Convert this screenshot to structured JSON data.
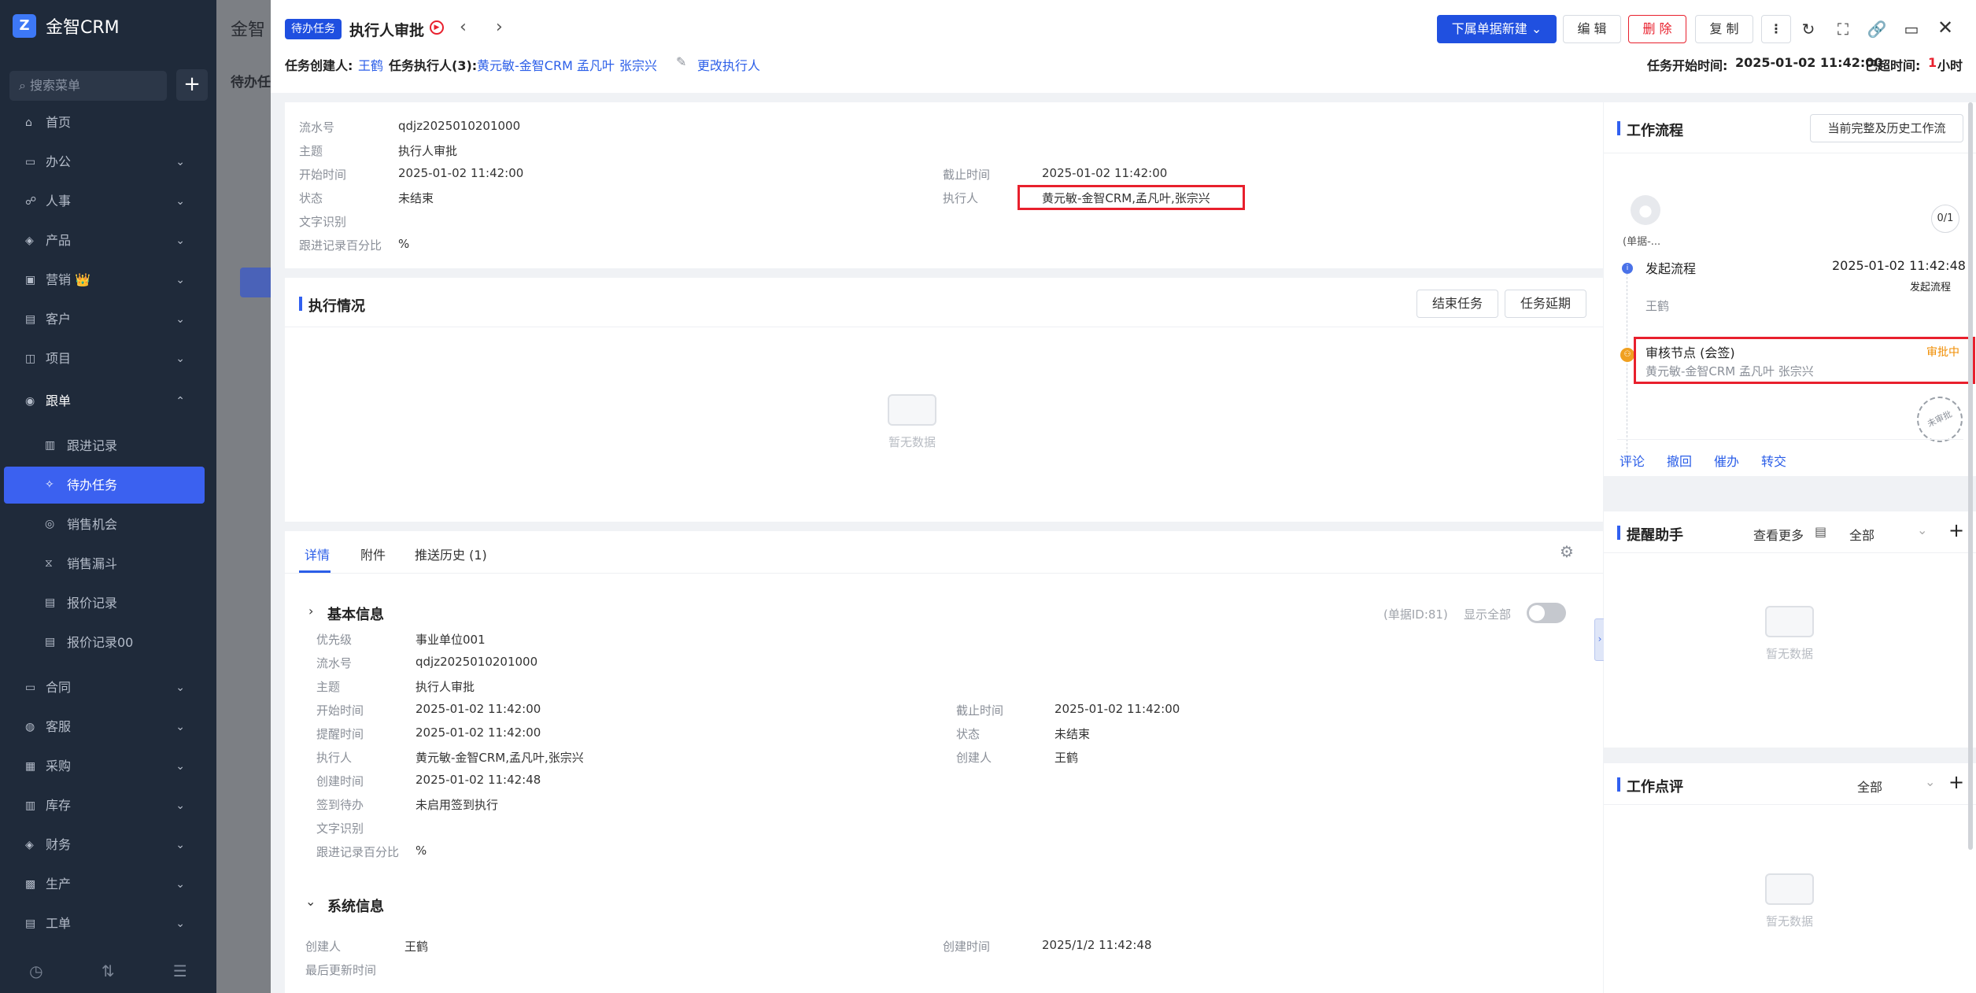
{
  "app": {
    "brand": "金智CRM",
    "search_placeholder": "搜索菜单"
  },
  "menu": [
    {
      "label": "首页",
      "icon": "home-icon"
    },
    {
      "label": "办公",
      "icon": "office-icon",
      "chevron": "down"
    },
    {
      "label": "人事",
      "icon": "people-icon",
      "chevron": "down"
    },
    {
      "label": "产品",
      "icon": "product-icon",
      "chevron": "down"
    },
    {
      "label": "营销",
      "icon": "marketing-icon",
      "badge": "👑",
      "chevron": "down"
    },
    {
      "label": "客户",
      "icon": "customer-icon",
      "chevron": "down"
    },
    {
      "label": "项目",
      "icon": "project-icon",
      "chevron": "down"
    },
    {
      "label": "跟单",
      "icon": "follow-icon",
      "chevron": "up"
    }
  ],
  "submenu": [
    {
      "label": "跟进记录"
    },
    {
      "label": "待办任务",
      "active": true
    },
    {
      "label": "销售机会"
    },
    {
      "label": "销售漏斗"
    },
    {
      "label": "报价记录"
    },
    {
      "label": "报价记录00"
    }
  ],
  "menu2": [
    {
      "label": "合同"
    },
    {
      "label": "客服"
    },
    {
      "label": "采购"
    },
    {
      "label": "库存"
    },
    {
      "label": "财务"
    },
    {
      "label": "生产"
    },
    {
      "label": "工单"
    }
  ],
  "bgpage": {
    "title": "金智",
    "sub": "待办任"
  },
  "header": {
    "tag": "待办任务",
    "title": "执行人审批",
    "creator_label": "任务创建人:",
    "creator": "王鹤",
    "executors_label": "任务执行人(3):",
    "executors": [
      "黄元敏-金智CRM",
      "孟凡叶",
      "张宗兴"
    ],
    "change_executor": "更改执行人",
    "start_label": "任务开始时间:",
    "start_time": "2025-01-02 11:42:00",
    "overdue_label": "已超时间:",
    "overdue_value": "1",
    "overdue_unit": "小时",
    "buttons": {
      "new_sub": "下属单据新建",
      "edit": "编 辑",
      "delete": "删 除",
      "copy": "复 制"
    }
  },
  "summary": {
    "rows": [
      {
        "label": "流水号",
        "value": "qdjz2025010201000"
      },
      {
        "label": "主题",
        "value": "执行人审批"
      },
      {
        "label": "开始时间",
        "value": "2025-01-02 11:42:00"
      },
      {
        "label": "状态",
        "value": "未结束"
      },
      {
        "label": "文字识别",
        "value": ""
      },
      {
        "label": "跟进记录百分比",
        "value": "%"
      }
    ],
    "right": [
      {
        "label": "截止时间",
        "value": "2025-01-02 11:42:00"
      },
      {
        "label": "执行人",
        "value": "黄元敏-金智CRM,孟凡叶,张宗兴"
      }
    ]
  },
  "execution": {
    "title": "执行情况",
    "end_task": "结束任务",
    "extend_task": "任务延期",
    "empty": "暂无数据"
  },
  "tabs": [
    {
      "label": "详情",
      "active": true
    },
    {
      "label": "附件"
    },
    {
      "label": "推送历史 (1)"
    }
  ],
  "basic_info": {
    "title": "基本信息",
    "doc_id": "(单据ID:81)",
    "show_all": "显示全部",
    "left": [
      {
        "label": "优先级",
        "value": "事业单位001"
      },
      {
        "label": "流水号",
        "value": "qdjz2025010201000"
      },
      {
        "label": "主题",
        "value": "执行人审批"
      },
      {
        "label": "开始时间",
        "value": "2025-01-02 11:42:00"
      },
      {
        "label": "提醒时间",
        "value": "2025-01-02 11:42:00"
      },
      {
        "label": "执行人",
        "value": "黄元敏-金智CRM,孟凡叶,张宗兴"
      },
      {
        "label": "创建时间",
        "value": "2025-01-02 11:42:48"
      },
      {
        "label": "签到待办",
        "value": "未启用签到执行"
      },
      {
        "label": "文字识别",
        "value": ""
      },
      {
        "label": "跟进记录百分比",
        "value": "%"
      }
    ],
    "right": [
      {
        "label": "截止时间",
        "value": "2025-01-02 11:42:00"
      },
      {
        "label": "状态",
        "value": "未结束"
      },
      {
        "label": "创建人",
        "value": "王鹤"
      }
    ]
  },
  "system_info": {
    "title": "系统信息",
    "creator_label": "创建人",
    "creator": "王鹤",
    "created_label": "创建时间",
    "created": "2025/1/2 11:42:48",
    "updated_label": "最后更新时间"
  },
  "workflow": {
    "title": "工作流程",
    "history_button": "当前完整及历史工作流",
    "avatar_caption": "(单据-...",
    "progress": "0/1",
    "steps": [
      {
        "name": "发起流程",
        "time": "2025-01-02 11:42:48",
        "status": "发起流程",
        "person": "王鹤"
      },
      {
        "name": "审核节点 (会签)",
        "status": "审批中",
        "person": "黄元敏-金智CRM 孟凡叶 张宗兴"
      }
    ],
    "stamp": "未审批",
    "actions": [
      "评论",
      "撤回",
      "催办",
      "转交"
    ]
  },
  "reminder": {
    "title": "提醒助手",
    "more": "查看更多",
    "filter": "全部",
    "empty": "暂无数据"
  },
  "review": {
    "title": "工作点评",
    "filter": "全部",
    "empty": "暂无数据"
  },
  "colors": {
    "accent": "#3160f0",
    "danger": "#e8202d",
    "warning": "#f08c00"
  }
}
